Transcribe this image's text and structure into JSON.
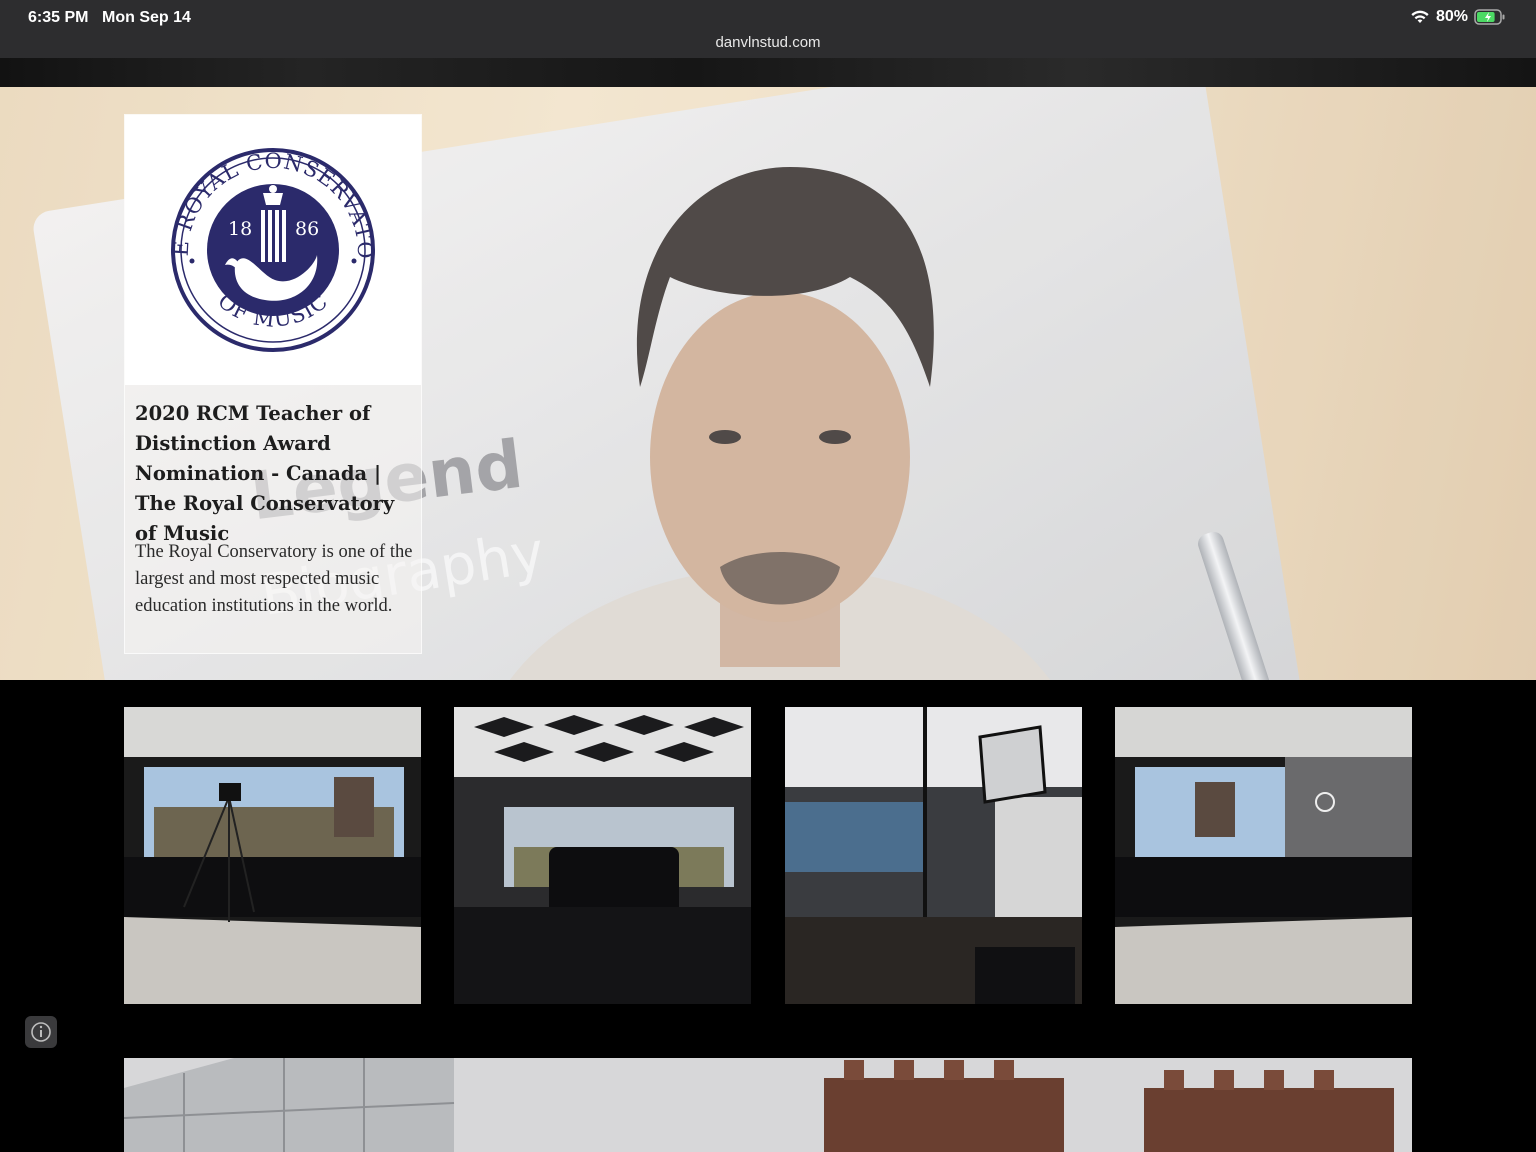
{
  "status_bar": {
    "time": "6:35 PM",
    "date": "Mon Sep 14",
    "url": "danvlnstud.com",
    "battery_percent": "80%",
    "battery_level": 0.8
  },
  "hero": {
    "background_book_title": "Legend",
    "background_book_subtitle": "Biography",
    "card": {
      "logo_ring_top_text": "THE ROYAL CONSERVATORY",
      "logo_ring_bottom_text": "OF MUSIC",
      "logo_year_left": "18",
      "logo_year_right": "86",
      "title": "2020 RCM Teacher of Distinction Award Nomination - Canada | The Royal Conservatory of Music",
      "description": "The Royal Conservatory is one of the largest and most respected music education institutions in the world."
    }
  },
  "gallery": {
    "items": [
      {
        "name": "studio-room-tripod"
      },
      {
        "name": "studio-camera-acoustic-ceiling"
      },
      {
        "name": "studio-lighting-rig"
      },
      {
        "name": "studio-room-wide"
      }
    ]
  },
  "colors": {
    "status_bar_bg": "#2d2d2f",
    "page_bg": "#000000",
    "rcm_navy": "#2b2a6b",
    "battery_green": "#4cd964"
  },
  "icons": [
    "wifi-icon",
    "battery-icon",
    "info-icon"
  ]
}
